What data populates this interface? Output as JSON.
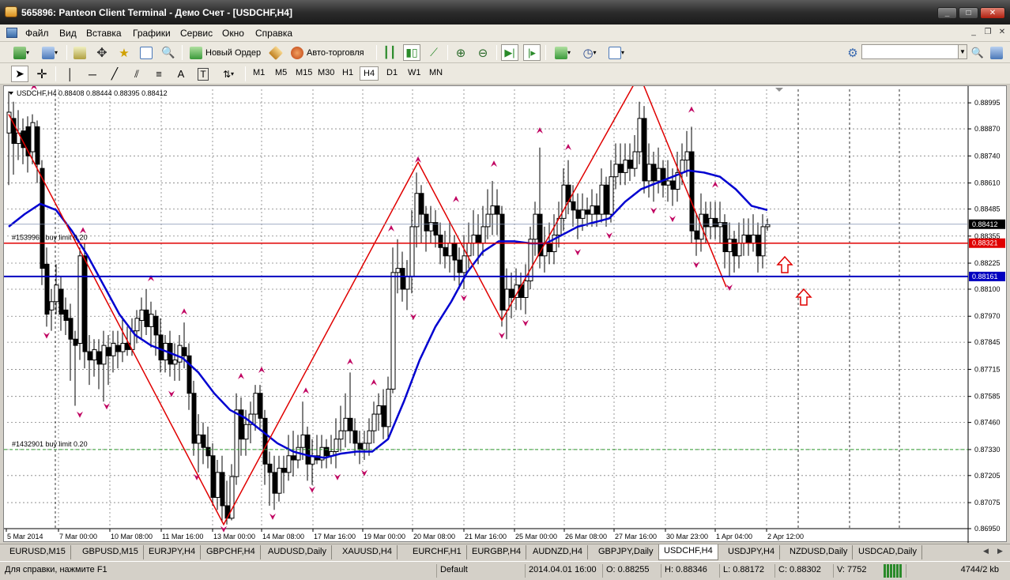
{
  "window": {
    "title": "565896: Panteon Client Terminal - Демо Счет - [USDCHF,H4]",
    "buttons": [
      "_",
      "□",
      "✕"
    ]
  },
  "menu": [
    "Файл",
    "Вид",
    "Вставка",
    "Графики",
    "Сервис",
    "Окно",
    "Справка"
  ],
  "toolbar": {
    "new_order": "Новый Ордер",
    "autotrading": "Авто-торговля",
    "timeframes": [
      "M1",
      "M5",
      "M15",
      "M30",
      "H1",
      "H4",
      "D1",
      "W1",
      "MN"
    ],
    "active_timeframe": "H4",
    "search_placeholder": ""
  },
  "chart": {
    "header": "USDCHF,H4  0.88408 0.88444 0.88395 0.88412",
    "order_labels": [
      "#1539961 buy limit 0.20",
      "#1432901 buy limit 0.20"
    ],
    "price_ticks": [
      "0.88995",
      "0.88870",
      "0.88740",
      "0.88610",
      "0.88485",
      "0.88355",
      "0.88225",
      "0.88100",
      "0.87970",
      "0.87845",
      "0.87715",
      "0.87585",
      "0.87460",
      "0.87330",
      "0.87205",
      "0.87075",
      "0.86950"
    ],
    "price_badges": [
      {
        "text": "0.88412",
        "bg": "#000000",
        "fg": "#ffffff"
      },
      {
        "text": "0.88321",
        "bg": "#e00000",
        "fg": "#ffffff"
      },
      {
        "text": "0.88161",
        "bg": "#0000c0",
        "fg": "#ffffff"
      }
    ],
    "time_ticks": [
      "5 Mar 2014",
      "7 Mar 00:00",
      "10 Mar 08:00",
      "11 Mar 16:00",
      "13 Mar 00:00",
      "14 Mar 08:00",
      "17 Mar 16:00",
      "19 Mar 00:00",
      "20 Mar 08:00",
      "21 Mar 16:00",
      "25 Mar 00:00",
      "26 Mar 08:00",
      "27 Mar 16:00",
      "30 Mar 23:00",
      "1 Apr 04:00",
      "2 Apr 12:00"
    ],
    "colors": {
      "zigzag": "#e00000",
      "ma": "#0000d0",
      "fractal": "#c00060",
      "grid": "#808080",
      "candle": "#000000"
    }
  },
  "chart_data": {
    "type": "line",
    "title": "USDCHF,H4",
    "ylim": [
      0.8695,
      0.8906
    ],
    "series": [
      {
        "values": [
          0.8894,
          0.8861,
          0.8799,
          0.8711,
          0.8697,
          0.8871,
          0.8825,
          0.8803,
          0.8846,
          0.8838,
          0.8913,
          0.8811
        ]
      },
      {
        "values": [
          0.884,
          0.885,
          0.883,
          0.879,
          0.876,
          0.8735,
          0.8729,
          0.8737,
          0.8781,
          0.8835,
          0.8842,
          0.8862,
          0.8866,
          0.8844
        ]
      }
    ],
    "levels": [
      0.88321,
      0.88161,
      0.8733
    ]
  },
  "tabs": [
    "EURUSD,M15",
    "GBPUSD,M15",
    "EURJPY,H4",
    "GBPCHF,H4",
    "AUDUSD,Daily",
    "XAUUSD,H4",
    "EURCHF,H1",
    "EURGBP,H4",
    "AUDNZD,H4",
    "GBPJPY,Daily",
    "USDCHF,H4",
    "USDJPY,H4",
    "NZDUSD,Daily",
    "USDCAD,Daily"
  ],
  "active_tab": "USDCHF,H4",
  "status": {
    "help": "Для справки, нажмите F1",
    "profile": "Default",
    "datetime": "2014.04.01 16:00",
    "open": "O: 0.88255",
    "high": "H: 0.88346",
    "low": "L: 0.88172",
    "close": "C: 0.88302",
    "volume": "V: 7752",
    "traffic": "4744/2 kb"
  }
}
